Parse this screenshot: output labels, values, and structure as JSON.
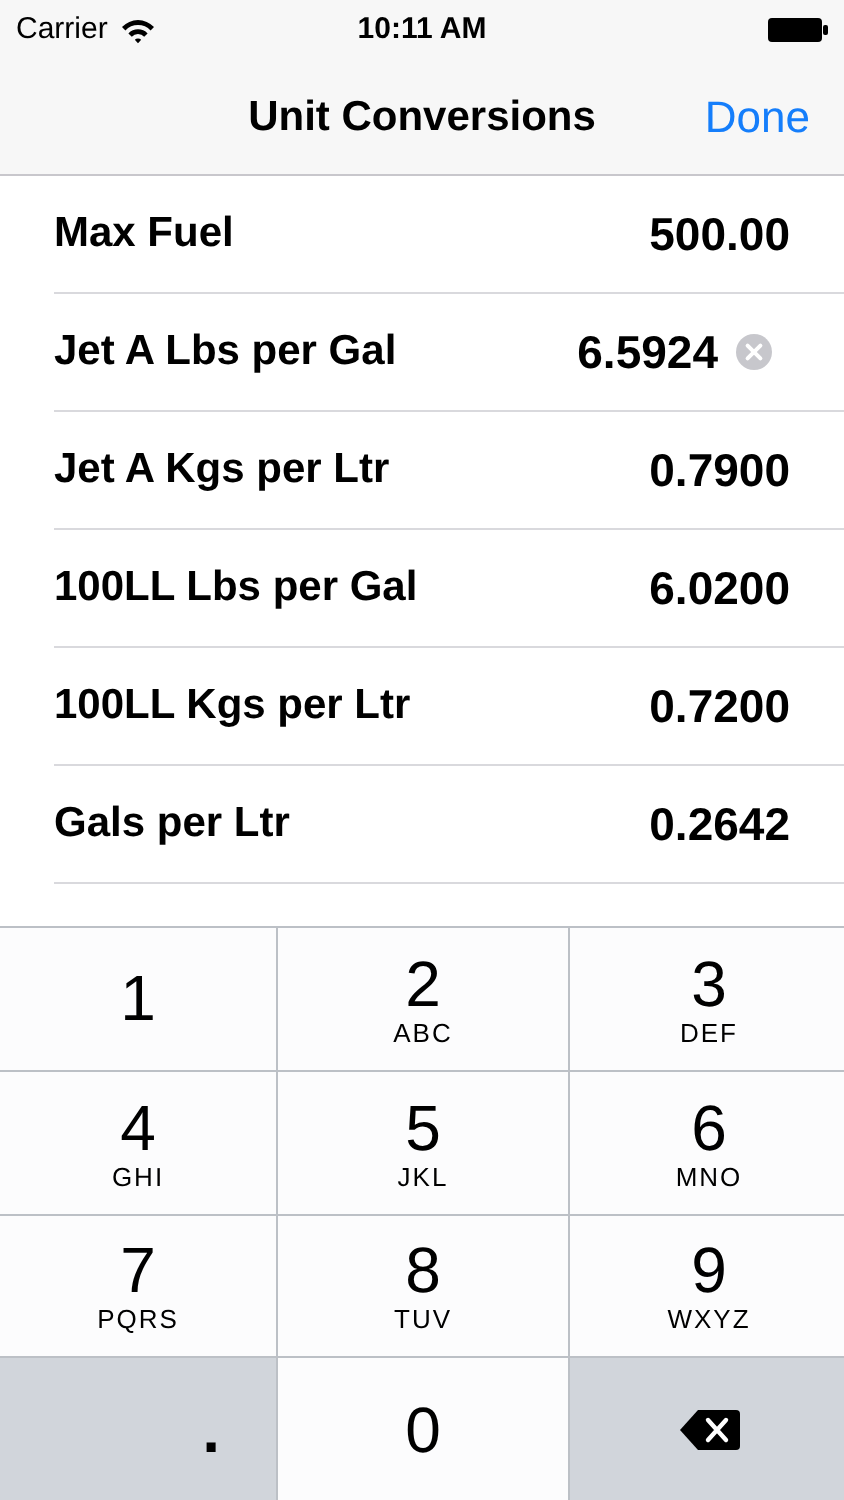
{
  "status_bar": {
    "carrier": "Carrier",
    "time": "10:11 AM"
  },
  "nav_bar": {
    "title": "Unit Conversions",
    "done": "Done"
  },
  "rows": [
    {
      "label": "Max Fuel",
      "value": "500.00",
      "editing": false
    },
    {
      "label": "Jet A Lbs per Gal",
      "value": "6.5924",
      "editing": true
    },
    {
      "label": "Jet A Kgs per Ltr",
      "value": "0.7900",
      "editing": false
    },
    {
      "label": "100LL Lbs per Gal",
      "value": "6.0200",
      "editing": false
    },
    {
      "label": "100LL Kgs per Ltr",
      "value": "0.7200",
      "editing": false
    },
    {
      "label": "Gals per Ltr",
      "value": "0.2642",
      "editing": false
    }
  ],
  "keypad": [
    {
      "kind": "digit",
      "digit": "1"
    },
    {
      "kind": "digit",
      "digit": "2",
      "letters": "ABC"
    },
    {
      "kind": "digit",
      "digit": "3",
      "letters": "DEF"
    },
    {
      "kind": "digit",
      "digit": "4",
      "letters": "GHI"
    },
    {
      "kind": "digit",
      "digit": "5",
      "letters": "JKL"
    },
    {
      "kind": "digit",
      "digit": "6",
      "letters": "MNO"
    },
    {
      "kind": "digit",
      "digit": "7",
      "letters": "PQRS"
    },
    {
      "kind": "digit",
      "digit": "8",
      "letters": "TUV"
    },
    {
      "kind": "digit",
      "digit": "9",
      "letters": "WXYZ"
    },
    {
      "kind": "symbol",
      "digit": "."
    },
    {
      "kind": "digit",
      "digit": "0"
    },
    {
      "kind": "delete"
    }
  ]
}
